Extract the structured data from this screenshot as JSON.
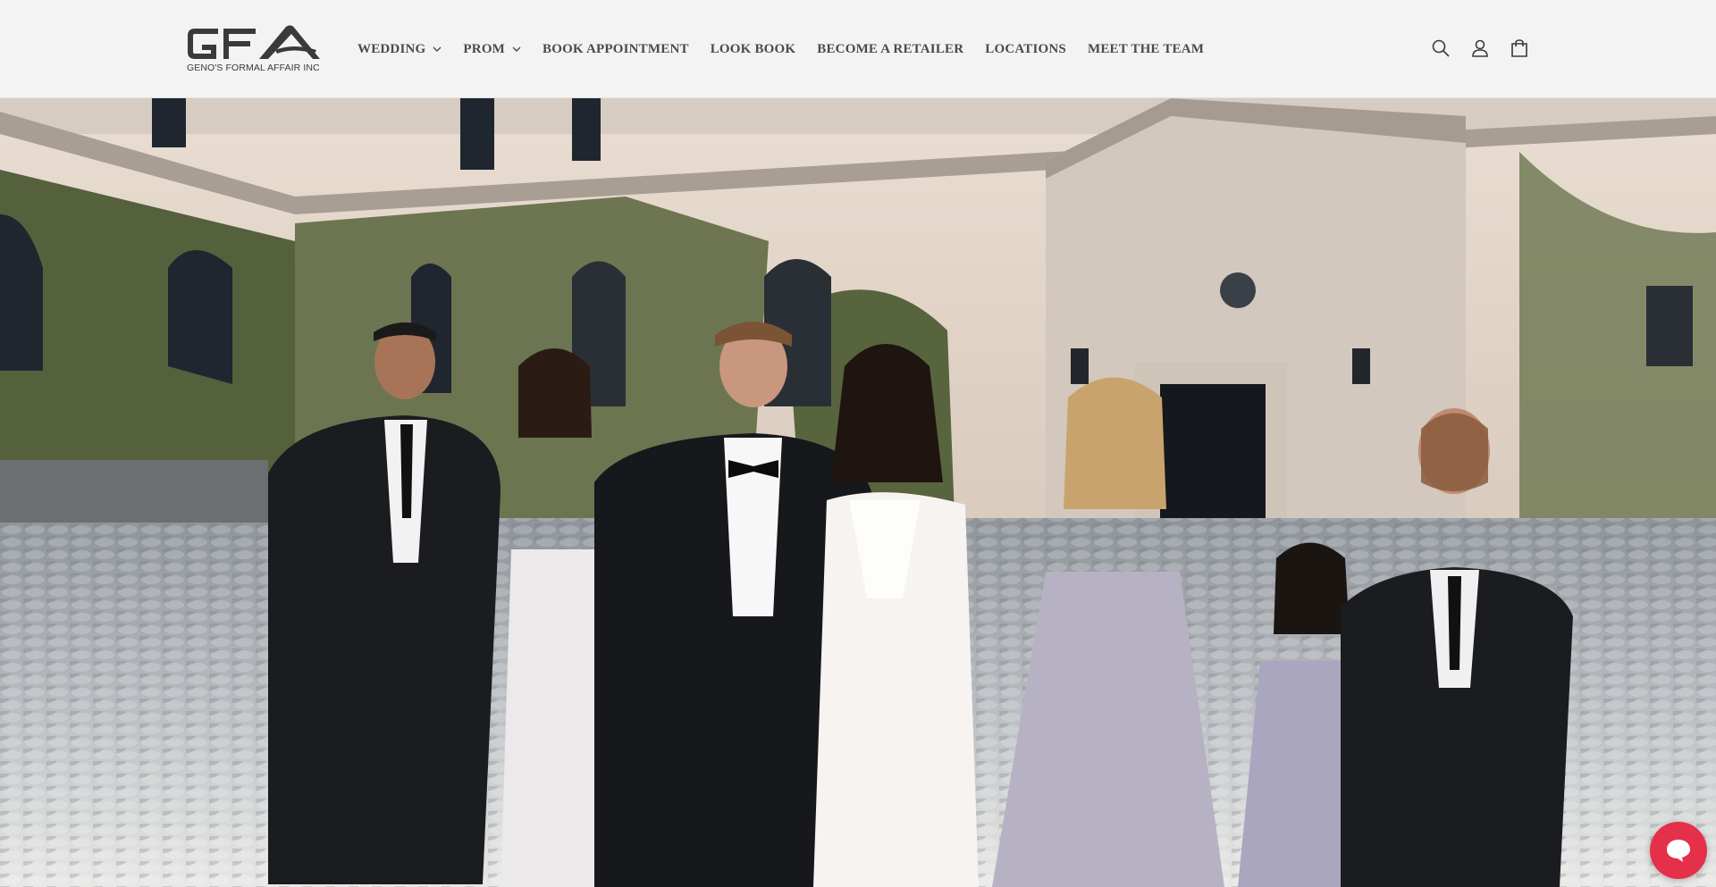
{
  "brand": {
    "logo_text": "GFA",
    "tagline": "GENO'S FORMAL AFFAIR INC"
  },
  "nav": {
    "items": [
      {
        "label": "WEDDING",
        "has_dropdown": true
      },
      {
        "label": "PROM",
        "has_dropdown": true
      },
      {
        "label": "BOOK APPOINTMENT",
        "has_dropdown": false
      },
      {
        "label": "LOOK BOOK",
        "has_dropdown": false
      },
      {
        "label": "BECOME A RETAILER",
        "has_dropdown": false
      },
      {
        "label": "LOCATIONS",
        "has_dropdown": false
      },
      {
        "label": "MEET THE TEAM",
        "has_dropdown": false
      }
    ]
  },
  "header_icons": [
    "search-icon",
    "account-icon",
    "cart-icon"
  ],
  "hero": {
    "image_subject": "wedding party walking on cobblestones in front of a stone estate"
  },
  "chat": {
    "icon": "chat-bubble-icon"
  },
  "colors": {
    "header_bg": "#f3f3f3",
    "nav_text": "#4a4a4a",
    "chat_accent": "#e5304a"
  }
}
